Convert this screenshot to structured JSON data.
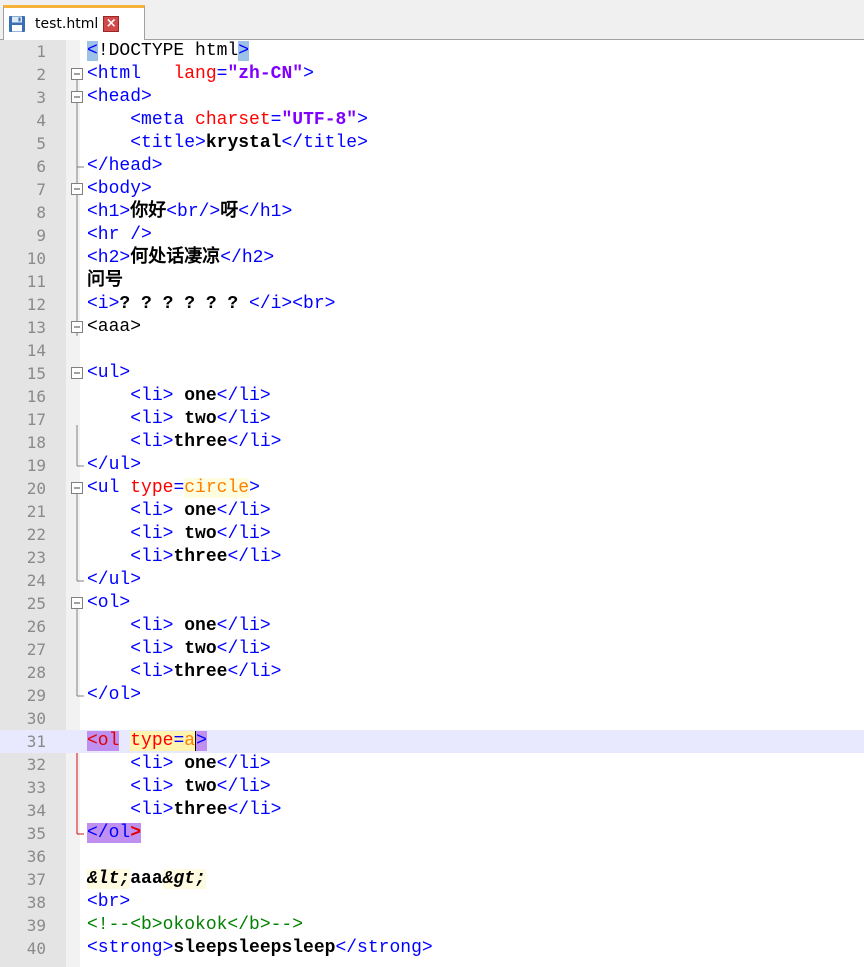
{
  "tab": {
    "title": "test.html",
    "close_glyph": "×",
    "icon": "floppy-disk-icon",
    "accent": "#f7b23b"
  },
  "editor": {
    "current_line": 31,
    "lines": [
      {
        "n": "1"
      },
      {
        "n": "2"
      },
      {
        "n": "3"
      },
      {
        "n": "4"
      },
      {
        "n": "5"
      },
      {
        "n": "6"
      },
      {
        "n": "7"
      },
      {
        "n": "8"
      },
      {
        "n": "9"
      },
      {
        "n": "10"
      },
      {
        "n": "11"
      },
      {
        "n": "12"
      },
      {
        "n": "13"
      },
      {
        "n": "14"
      },
      {
        "n": "15"
      },
      {
        "n": "16"
      },
      {
        "n": "17"
      },
      {
        "n": "18"
      },
      {
        "n": "19"
      },
      {
        "n": "20"
      },
      {
        "n": "21"
      },
      {
        "n": "22"
      },
      {
        "n": "23"
      },
      {
        "n": "24"
      },
      {
        "n": "25"
      },
      {
        "n": "26"
      },
      {
        "n": "27"
      },
      {
        "n": "28"
      },
      {
        "n": "29"
      },
      {
        "n": "30"
      },
      {
        "n": "31"
      },
      {
        "n": "32"
      },
      {
        "n": "33"
      },
      {
        "n": "34"
      },
      {
        "n": "35"
      },
      {
        "n": "36"
      },
      {
        "n": "37"
      },
      {
        "n": "38"
      },
      {
        "n": "39"
      },
      {
        "n": "40"
      }
    ],
    "tokens": {
      "l1": [
        "<",
        "!DOCTYPE html",
        ">"
      ],
      "l2": [
        "<html",
        "   ",
        "lang",
        "=",
        "\"zh-CN\"",
        ">"
      ],
      "l3": [
        "<head>"
      ],
      "l4": [
        "    ",
        "<meta",
        " ",
        "charset",
        "=",
        "\"UTF-8\"",
        ">"
      ],
      "l5": [
        "    ",
        "<title>",
        "krystal",
        "</title>"
      ],
      "l6": [
        "</head>"
      ],
      "l7": [
        "<body>"
      ],
      "l8": [
        "<h1>",
        "你好",
        "<br/>",
        "呀",
        "</h1>"
      ],
      "l9": [
        "<hr />"
      ],
      "l10": [
        "<h2>",
        "何处话凄凉",
        "</h2>"
      ],
      "l11": [
        "问号"
      ],
      "l12": [
        "<i>",
        "? ? ? ? ? ? ",
        "</i>",
        "<br>"
      ],
      "l13": [
        "<aaa>"
      ],
      "l15": [
        "<ul>"
      ],
      "l16": [
        "    ",
        "<li>",
        " one",
        "</li>"
      ],
      "l17": [
        "    ",
        "<li>",
        " two",
        "</li>"
      ],
      "l18": [
        "    ",
        "<li>",
        "three",
        "</li>"
      ],
      "l19": [
        "</ul>"
      ],
      "l20": [
        "<ul",
        " ",
        "type",
        "=",
        "circle",
        ">"
      ],
      "l21": [
        "    ",
        "<li>",
        " one",
        "</li>"
      ],
      "l22": [
        "    ",
        "<li>",
        " two",
        "</li>"
      ],
      "l23": [
        "    ",
        "<li>",
        "three",
        "</li>"
      ],
      "l24": [
        "</ul>"
      ],
      "l25": [
        "<ol>"
      ],
      "l26": [
        "    ",
        "<li>",
        " one",
        "</li>"
      ],
      "l27": [
        "    ",
        "<li>",
        " two",
        "</li>"
      ],
      "l28": [
        "    ",
        "<li>",
        "three",
        "</li>"
      ],
      "l29": [
        "</ol>"
      ],
      "l31": [
        "<ol",
        " ",
        "type",
        "=",
        "a",
        ">"
      ],
      "l32": [
        "    ",
        "<li>",
        " one",
        "</li>"
      ],
      "l33": [
        "    ",
        "<li>",
        " two",
        "</li>"
      ],
      "l34": [
        "    ",
        "<li>",
        "three",
        "</li>"
      ],
      "l35": [
        "</ol",
        ">"
      ],
      "l37": [
        "&lt;",
        "aaa",
        "&gt;"
      ],
      "l38": [
        "<br>"
      ],
      "l39": [
        "<!--<b>okokok</b>-->"
      ],
      "l40": [
        "<strong>",
        "sleepsleepsleep",
        "</strong>"
      ]
    }
  }
}
